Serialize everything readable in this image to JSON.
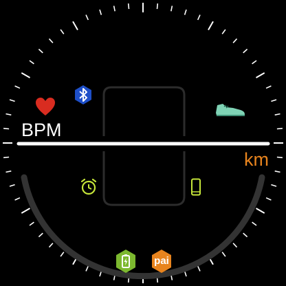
{
  "watchface": {
    "heart_rate": {
      "unit_label": "BPM",
      "icon": "heart-icon"
    },
    "distance": {
      "unit_label": "km",
      "icon": "sneaker-icon"
    },
    "status": {
      "bluetooth_icon": "bluetooth-icon",
      "alarm_icon": "alarm-clock-icon",
      "phone_icon": "phone-icon",
      "battery_icon": "battery-charging-icon",
      "pai": {
        "label": "pai",
        "icon": "pai-badge-icon"
      }
    },
    "colors": {
      "background": "#000000",
      "text_primary": "#ffffff",
      "distance_accent": "#e8841e",
      "heart": "#d92c20",
      "bluetooth": "#1e4fc8",
      "sneaker": "#7fd3b5",
      "alarm": "#c6e63a",
      "phone": "#c6e63a",
      "battery_badge": "#7cb82f",
      "pai_badge": "#e8841e",
      "arc": "#333333",
      "divider": "#ffffff"
    }
  }
}
